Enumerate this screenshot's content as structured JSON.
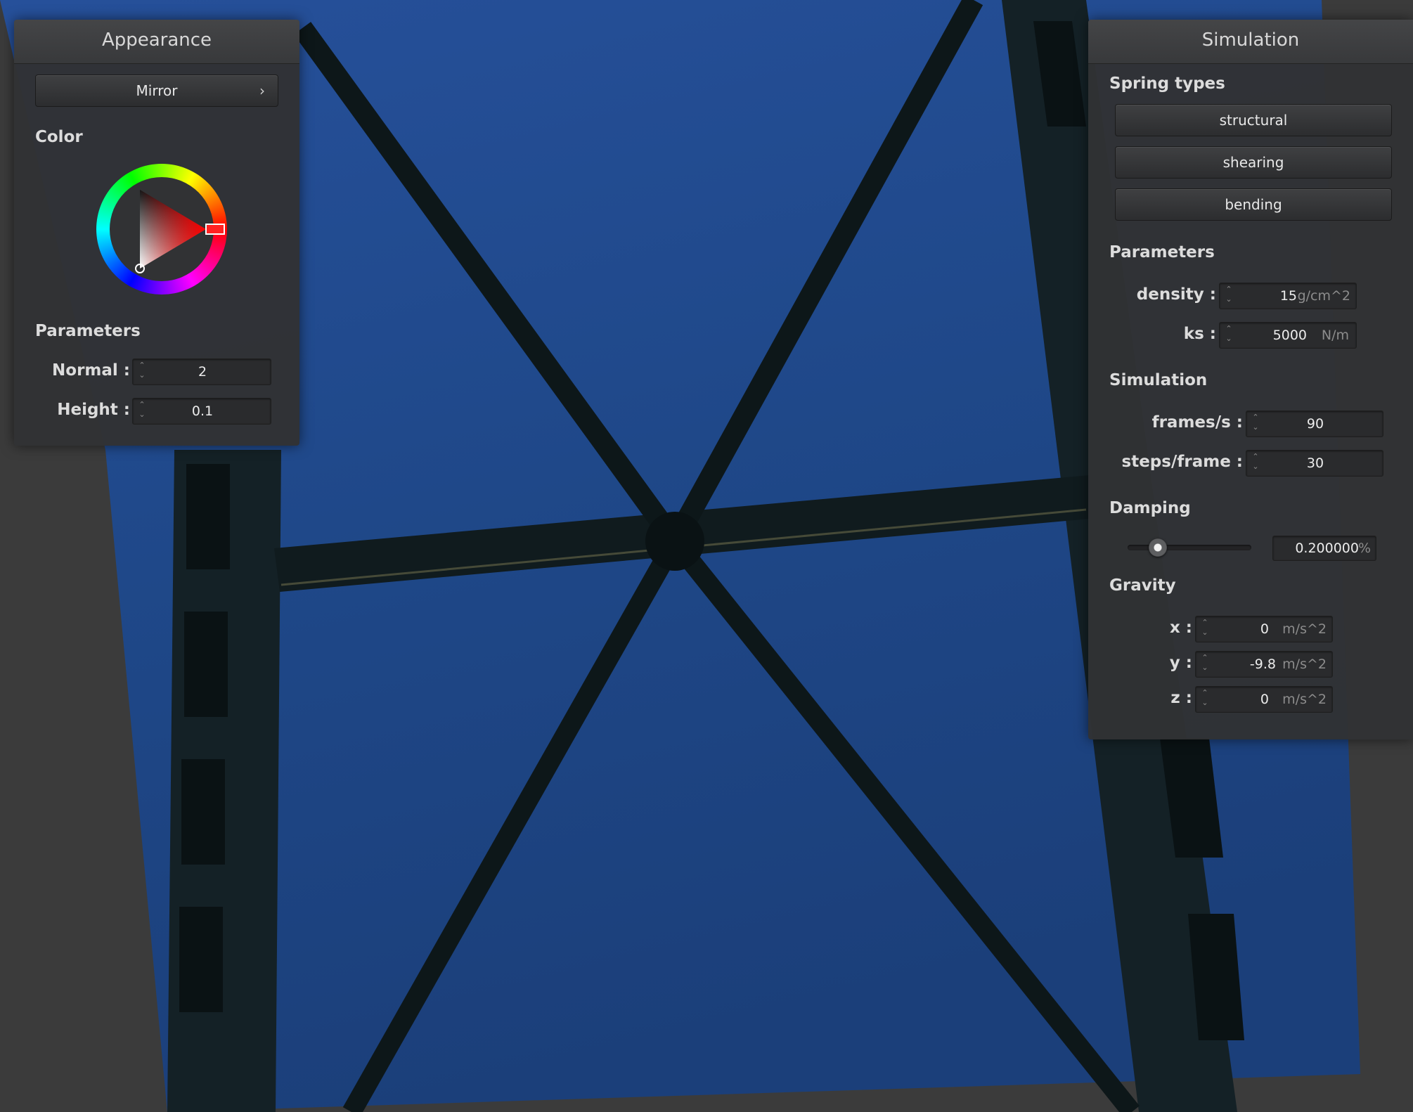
{
  "appearance": {
    "title": "Appearance",
    "shader_button": "Mirror",
    "color_label": "Color",
    "selected_color": "#ff0000",
    "parameters_label": "Parameters",
    "normal_label": "Normal :",
    "normal_value": "2",
    "height_label": "Height :",
    "height_value": "0.1"
  },
  "simulation": {
    "title": "Simulation",
    "spring_types_label": "Spring types",
    "spring_types": [
      "structural",
      "shearing",
      "bending"
    ],
    "parameters_label": "Parameters",
    "density_label": "density :",
    "density_value": "15",
    "density_unit": "g/cm^2",
    "ks_label": "ks :",
    "ks_value": "5000",
    "ks_unit": "N/m",
    "simulation_label": "Simulation",
    "fps_label": "frames/s :",
    "fps_value": "90",
    "steps_label": "steps/frame :",
    "steps_value": "30",
    "damping_label": "Damping",
    "damping_value": "0.200000",
    "damping_unit": "%",
    "damping_fraction": 0.2,
    "gravity_label": "Gravity",
    "gravity": [
      {
        "label": "x :",
        "value": "0",
        "unit": "m/s^2"
      },
      {
        "label": "y :",
        "value": "-9.8",
        "unit": "m/s^2"
      },
      {
        "label": "z :",
        "value": "0",
        "unit": "m/s^2"
      }
    ]
  },
  "viewport": {
    "sky_color": "#1f4a8a",
    "frame_color": "#0f1a1c"
  },
  "icons": {
    "chevron": "›",
    "spin": "⌃⌄"
  }
}
